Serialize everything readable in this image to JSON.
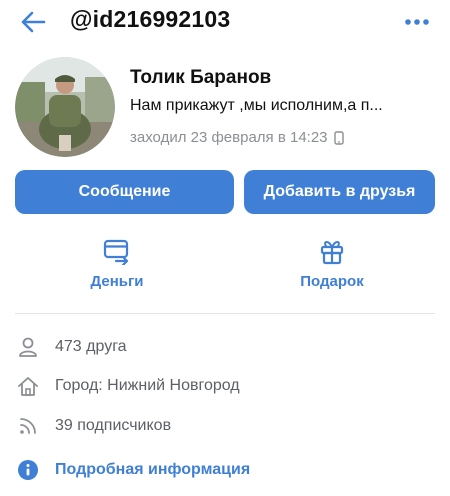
{
  "header": {
    "title": "@id216992103",
    "back_icon": "arrow-left-icon",
    "more_icon": "more-dots-icon"
  },
  "profile": {
    "name": "Толик Баранов",
    "status": "Нам прикажут ,мы исполним,а п...",
    "last_seen": "заходил 23 февраля в 14:23",
    "device_icon": "phone-icon"
  },
  "buttons": {
    "message": "Сообщение",
    "add_friend": "Добавить в друзья"
  },
  "actions": {
    "money": {
      "label": "Деньги",
      "icon": "money-transfer-icon"
    },
    "gift": {
      "label": "Подарок",
      "icon": "gift-icon"
    }
  },
  "info": {
    "friends": {
      "text": "473 друга",
      "icon": "user-icon"
    },
    "city": {
      "text": "Город: Нижний Новгород",
      "icon": "home-icon"
    },
    "followers": {
      "text": "39 подписчиков",
      "icon": "rss-icon"
    },
    "details": {
      "text": "Подробная информация",
      "icon": "info-icon"
    }
  },
  "colors": {
    "accent": "#3f7fd6",
    "text_secondary": "#8c8f94",
    "text_info": "#5d6066",
    "divider": "#e3e4e8"
  }
}
